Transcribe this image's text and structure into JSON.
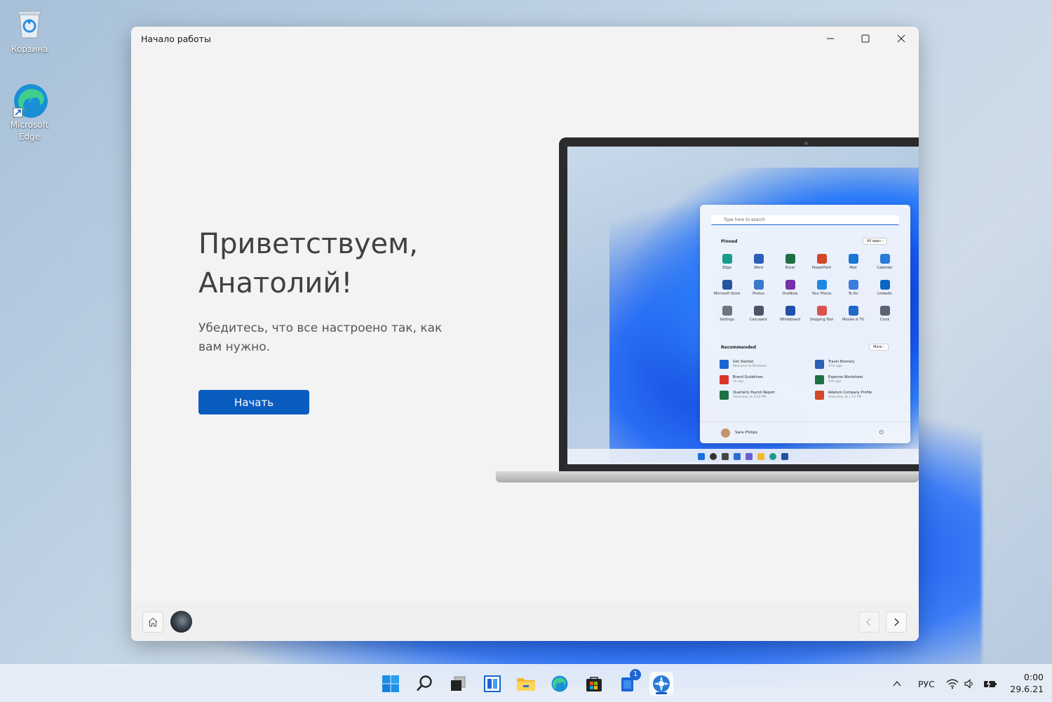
{
  "desktop": {
    "icons": [
      {
        "label": "Корзина",
        "icon": "recycle-bin-icon"
      },
      {
        "label": "Microsoft Edge",
        "icon": "edge-icon"
      }
    ]
  },
  "window": {
    "title": "Начало работы",
    "controls": {
      "minimize": "minimize-icon",
      "maximize": "maximize-icon",
      "close": "close-icon"
    },
    "hero": {
      "title_line1": "Приветствуем,",
      "title_line2": "Анатолий!",
      "subtitle": "Убедитесь, что все настроено так, как вам нужно.",
      "button_label": "Начать"
    },
    "illustration": {
      "search_placeholder": "Type here to search",
      "pinned_label": "Pinned",
      "all_apps_label": "All apps  ›",
      "pinned_apps": [
        {
          "name": "Edge",
          "color": "#1a9c8c"
        },
        {
          "name": "Word",
          "color": "#2b5fb8"
        },
        {
          "name": "Excel",
          "color": "#1d7044"
        },
        {
          "name": "PowerPoint",
          "color": "#d24726"
        },
        {
          "name": "Mail",
          "color": "#1976d2"
        },
        {
          "name": "Calendar",
          "color": "#2a7ad8"
        },
        {
          "name": "Microsoft Store",
          "color": "#25559c"
        },
        {
          "name": "Photos",
          "color": "#3a79c8"
        },
        {
          "name": "OneNote",
          "color": "#7a2fa8"
        },
        {
          "name": "Your Phone",
          "color": "#1e88e5"
        },
        {
          "name": "To Do",
          "color": "#3d7be0"
        },
        {
          "name": "LinkedIn",
          "color": "#0a66c2"
        },
        {
          "name": "Settings",
          "color": "#6d7680"
        },
        {
          "name": "Calculator",
          "color": "#4b5563"
        },
        {
          "name": "Whiteboard",
          "color": "#1f4fa8"
        },
        {
          "name": "Snipping Tool",
          "color": "#d9534f"
        },
        {
          "name": "Movies & TV",
          "color": "#2268c8"
        },
        {
          "name": "Clock",
          "color": "#5a6470"
        }
      ],
      "recommended_label": "Recommended",
      "more_label": "More  ›",
      "recommended": [
        {
          "title": "Get Started",
          "sub": "Welcome to Windows",
          "color": "#1a64d4"
        },
        {
          "title": "Travel Itinerary",
          "sub": "17m ago",
          "color": "#2b5fb8"
        },
        {
          "title": "Brand Guidelines",
          "sub": "2h ago",
          "color": "#d9342b"
        },
        {
          "title": "Expense Worksheet",
          "sub": "12h ago",
          "color": "#1d7044"
        },
        {
          "title": "Quarterly Payroll Report",
          "sub": "Yesterday at 4:24 PM",
          "color": "#1d7044"
        },
        {
          "title": "Adatum Company Profile",
          "sub": "Yesterday at 1:15 PM",
          "color": "#d24726"
        }
      ],
      "user_name": "Sara Philips"
    },
    "bottom": {
      "home": "home-icon",
      "back": "chevron-left-icon",
      "forward": "chevron-right-icon"
    }
  },
  "taskbar": {
    "apps": [
      {
        "name": "start",
        "icon": "windows-logo-icon"
      },
      {
        "name": "search",
        "icon": "search-icon"
      },
      {
        "name": "task-view",
        "icon": "task-view-icon"
      },
      {
        "name": "widgets",
        "icon": "widgets-icon"
      },
      {
        "name": "file-explorer",
        "icon": "folder-icon"
      },
      {
        "name": "edge",
        "icon": "edge-icon"
      },
      {
        "name": "store",
        "icon": "store-icon"
      },
      {
        "name": "notes",
        "icon": "notes-icon",
        "badge": "1"
      },
      {
        "name": "get-started",
        "icon": "get-started-icon",
        "active": true
      }
    ],
    "tray": {
      "language": "РУС",
      "time": "0:00",
      "date": "29.6.21"
    }
  }
}
